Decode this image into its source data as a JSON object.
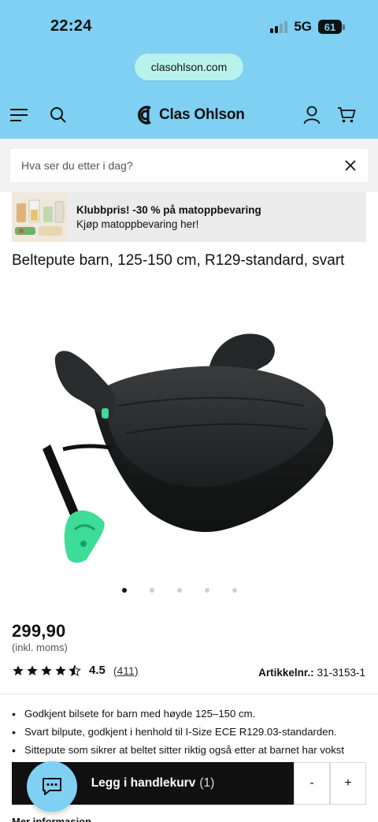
{
  "status_bar": {
    "time": "22:24",
    "network": "5G",
    "battery": "61"
  },
  "browser": {
    "url": "clasohlson.com"
  },
  "header": {
    "brand": "Clas Ohlson",
    "icons": [
      "menu-icon",
      "search-icon",
      "account-icon",
      "cart-icon"
    ]
  },
  "search": {
    "placeholder": "Hva ser du etter i dag?"
  },
  "promo": {
    "title": "Klubbpris! -30 % på matoppbevaring",
    "subtitle": "Kjøp matoppbevaring her!"
  },
  "product": {
    "title": "Beltepute barn, 125-150 cm, R129-standard, svart",
    "image_count": 5,
    "active_image": 1,
    "price": "299,90",
    "vat_note": "(inkl. moms)",
    "rating_value": "4.5",
    "rating_stars": 4.5,
    "rating_count": "(411)",
    "article_label": "Artikkelnr.:",
    "article_number": "31-3153-1",
    "bullets": [
      "Godkjent bilsete for barn med høyde 125–150 cm.",
      "Svart bilpute, godkjent i henhold til I-Size ECE R129.03-standarden.",
      "Sittepute som sikrer at beltet sitter riktig også etter at barnet har vokst"
    ],
    "more_info": "Mer informasjon"
  },
  "cart": {
    "add_label": "Legg i handlekurv",
    "count": "(1)",
    "minus": "-",
    "plus": "+"
  },
  "colors": {
    "accent": "#7fd0f3",
    "url_pill": "#b8f2ec",
    "product_green": "#3ddc97"
  }
}
